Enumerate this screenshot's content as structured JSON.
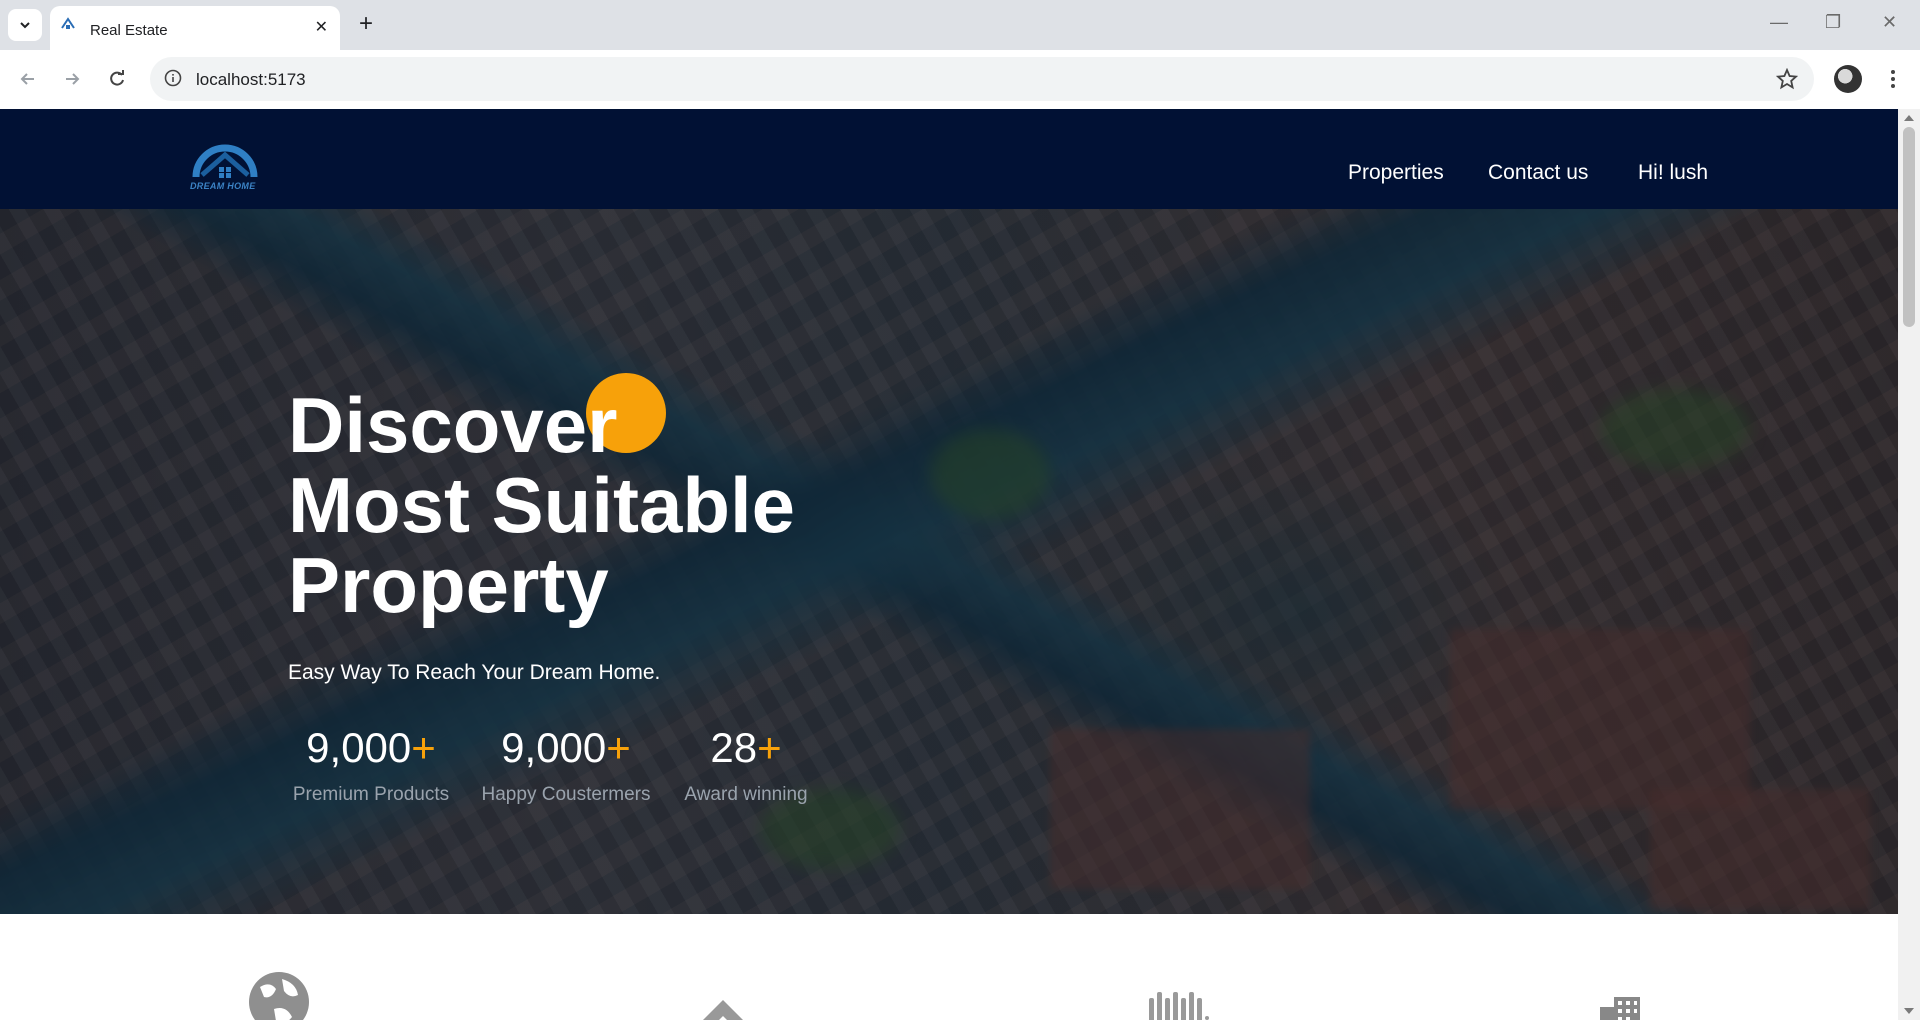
{
  "browser": {
    "tab_title": "Real Estate",
    "url": "localhost:5173"
  },
  "site": {
    "logo_text": "DREAM HOME",
    "nav": [
      "Properties",
      "Contact us",
      "Hi! lush"
    ]
  },
  "hero": {
    "headline": [
      "Discover",
      "Most Suitable",
      "Property"
    ],
    "subtitle": "Easy Way To Reach Your Dream Home.",
    "stats": [
      {
        "number": "9,000",
        "plus": "+",
        "label": "Premium Products"
      },
      {
        "number": "9,000",
        "plus": "+",
        "label": "Happy Coustermers"
      },
      {
        "number": "28",
        "plus": "+",
        "label": "Award winning"
      }
    ],
    "accent_color": "#f7a10a"
  },
  "features": {
    "icons": [
      "globe-icon",
      "pyramid-icon",
      "waveform-logo-icon",
      "building-icon"
    ]
  },
  "colors": {
    "header_bg": "#011134",
    "accent": "#f7a10a"
  }
}
